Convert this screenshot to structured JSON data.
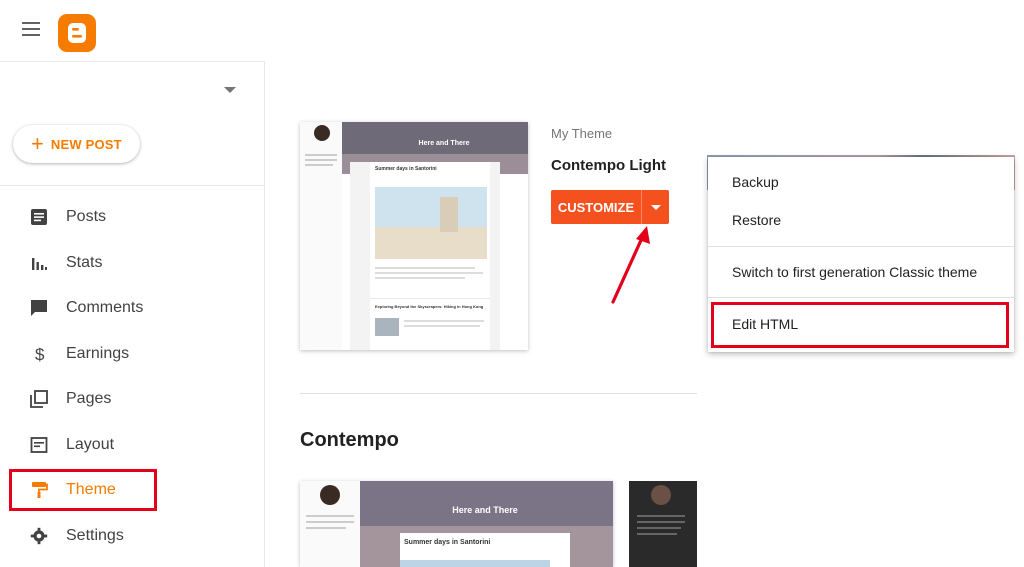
{
  "header": {
    "menu_icon": "hamburger-menu-icon",
    "logo_icon": "blogger-logo-icon",
    "brand_color": "#f57c00"
  },
  "sidebar": {
    "new_post_label": "NEW POST",
    "items": [
      {
        "label": "Posts",
        "icon": "posts-icon",
        "active": false
      },
      {
        "label": "Stats",
        "icon": "stats-icon",
        "active": false
      },
      {
        "label": "Comments",
        "icon": "comments-icon",
        "active": false
      },
      {
        "label": "Earnings",
        "icon": "dollar-icon",
        "active": false
      },
      {
        "label": "Pages",
        "icon": "pages-icon",
        "active": false
      },
      {
        "label": "Layout",
        "icon": "layout-icon",
        "active": false
      },
      {
        "label": "Theme",
        "icon": "theme-roller-icon",
        "active": true
      },
      {
        "label": "Settings",
        "icon": "gear-icon",
        "active": false
      }
    ]
  },
  "main": {
    "my_theme_label": "My Theme",
    "theme_name": "Contempo Light",
    "customize_label": "CUSTOMIZE",
    "section_heading": "Contempo",
    "preview": {
      "blog_title": "Here and There",
      "post1_title": "Summer days in Santorini",
      "post2_title": "Exploring Beyond the Skyscrapers: Hiking in Hong Kong"
    }
  },
  "menu": {
    "items": [
      {
        "label": "Backup"
      },
      {
        "label": "Restore"
      },
      {
        "label": "Switch to first generation Classic theme"
      },
      {
        "label": "Edit HTML"
      }
    ]
  },
  "colors": {
    "accent": "#f4511e",
    "highlight": "#e2001a"
  }
}
